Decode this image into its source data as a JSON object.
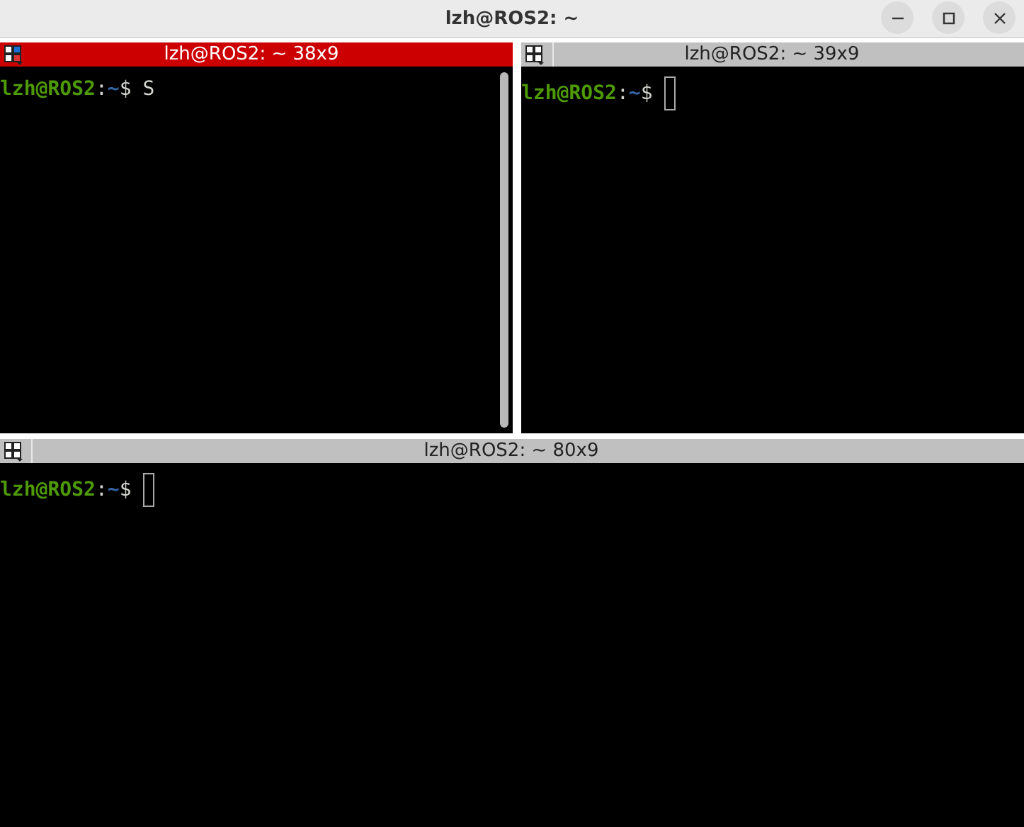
{
  "window": {
    "title": "lzh@ROS2: ~"
  },
  "panes": [
    {
      "title": "lzh@ROS2: ~ 38x9",
      "active": true,
      "prompt": {
        "user_host": "lzh@ROS2",
        "separator": ":",
        "path": "~",
        "symbol": "$"
      },
      "input": "S",
      "scrollbar": true
    },
    {
      "title": "lzh@ROS2: ~ 39x9",
      "active": false,
      "prompt": {
        "user_host": "lzh@ROS2",
        "separator": ":",
        "path": "~",
        "symbol": "$"
      }
    },
    {
      "title": "lzh@ROS2: ~ 80x9",
      "active": false,
      "prompt": {
        "user_host": "lzh@ROS2",
        "separator": ":",
        "path": "~",
        "symbol": "$"
      }
    }
  ]
}
